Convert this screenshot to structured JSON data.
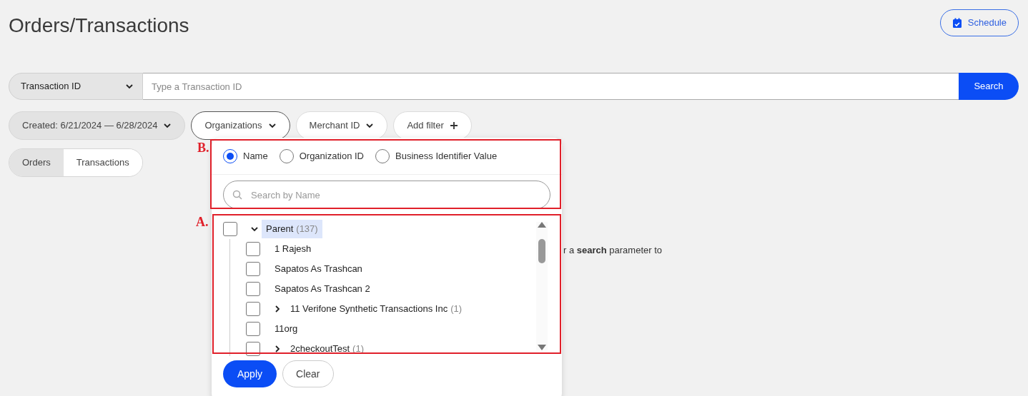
{
  "page": {
    "title": "Orders/Transactions"
  },
  "schedule_button": {
    "label": "Schedule"
  },
  "search_bar": {
    "type_select": "Transaction ID",
    "placeholder": "Type a Transaction ID",
    "button": "Search"
  },
  "filters": [
    {
      "label": "Created: 6/21/2024 — 6/28/2024",
      "kind": "dropdown",
      "applied": true,
      "expanded": false
    },
    {
      "label": "Organizations",
      "kind": "dropdown",
      "applied": false,
      "expanded": true
    },
    {
      "label": "Merchant ID",
      "kind": "dropdown",
      "applied": false,
      "expanded": false
    },
    {
      "label": "Add filter",
      "kind": "add",
      "applied": false,
      "expanded": false
    }
  ],
  "view_tabs": [
    {
      "label": "Orders",
      "selected": false
    },
    {
      "label": "Transactions",
      "selected": true
    }
  ],
  "hint": "r a **search** parameter to",
  "organizations_dropdown": {
    "search_by": [
      {
        "label": "Name",
        "selected": true
      },
      {
        "label": "Organization ID",
        "selected": false
      },
      {
        "label": "Business Identifier Value",
        "selected": false
      }
    ],
    "search_placeholder": "Search by Name",
    "tree": [
      {
        "label": "Parent",
        "count": "(137)",
        "checked": false,
        "expanded": true,
        "highlighted": true,
        "children": [
          {
            "label": "1 Rajesh",
            "checked": false
          },
          {
            "label": "Sapatos As Trashcan",
            "checked": false
          },
          {
            "label": "Sapatos As Trashcan 2",
            "checked": false
          },
          {
            "label": "11 Verifone Synthetic Transactions Inc",
            "count": "(1)",
            "checked": false,
            "expanded": false
          },
          {
            "label": "11org",
            "checked": false
          },
          {
            "label": "2checkoutTest",
            "count": "(1)",
            "checked": false,
            "expanded": false
          }
        ]
      }
    ],
    "apply_button": "Apply",
    "clear_button": "Clear"
  },
  "annotations": [
    {
      "label": "B."
    },
    {
      "label": "A."
    }
  ]
}
